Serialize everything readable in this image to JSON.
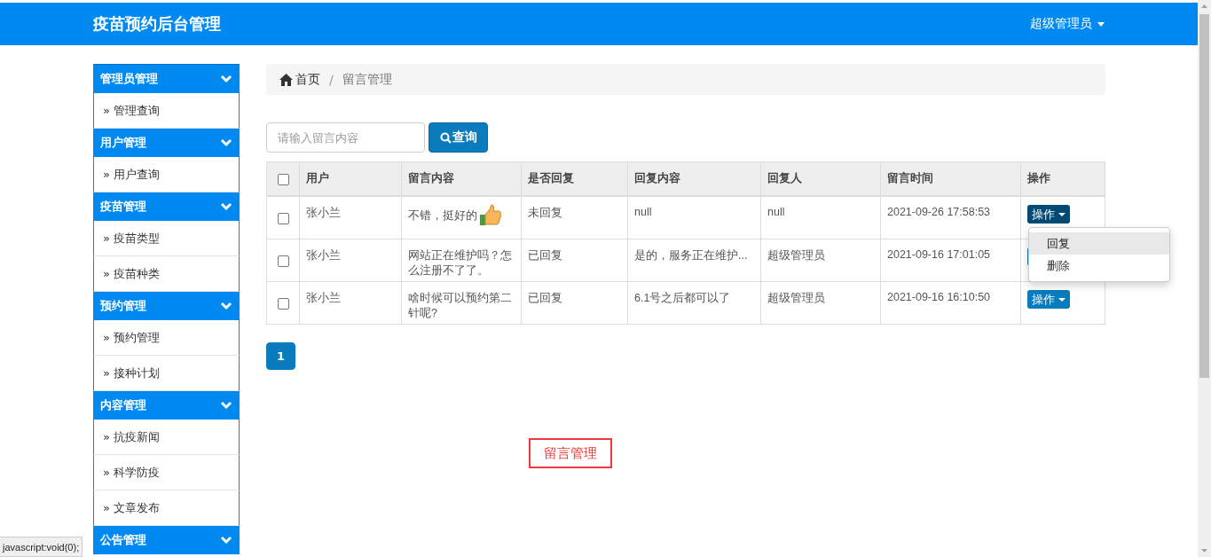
{
  "header": {
    "title": "疫苗预约后台管理",
    "user_menu": "超级管理员"
  },
  "sidebar": {
    "groups": [
      {
        "title": "管理员管理",
        "items": [
          "» 管理查询"
        ]
      },
      {
        "title": "用户管理",
        "items": [
          "» 用户查询"
        ]
      },
      {
        "title": "疫苗管理",
        "items": [
          "» 疫苗类型",
          "» 疫苗种类"
        ]
      },
      {
        "title": "预约管理",
        "items": [
          "» 预约管理",
          "» 接种计划"
        ]
      },
      {
        "title": "内容管理",
        "items": [
          "» 抗疫新闻",
          "» 科学防疫",
          "» 文章发布"
        ]
      },
      {
        "title": "公告管理"
      }
    ]
  },
  "breadcrumb": {
    "home": "首页",
    "separator": "/",
    "current": "留言管理"
  },
  "search": {
    "placeholder": "请输入留言内容",
    "button": "查询"
  },
  "table": {
    "columns": [
      "用户",
      "留言内容",
      "是否回复",
      "回复内容",
      "回复人",
      "留言时间",
      "操作"
    ],
    "header_checked": false,
    "rows": [
      {
        "checked": false,
        "user": "张小兰",
        "content": "不错，挺好的",
        "emoticon": true,
        "replied": "未回复",
        "reply": "null",
        "replier": "null",
        "time": "2021-09-26 17:58:53",
        "action": "操作",
        "open": true,
        "menu": [
          {
            "label": "回复",
            "selected": true
          },
          {
            "label": "删除",
            "selected": false
          }
        ]
      },
      {
        "checked": false,
        "user": "张小兰",
        "content": "网站正在维护吗？怎么注册不了了。",
        "emoticon": false,
        "replied": "已回复",
        "reply": "是的，服务正在维护...",
        "replier": "超级管理员",
        "time": "2021-09-16 17:01:05",
        "open": false
      },
      {
        "checked": false,
        "user": "张小兰",
        "content": "啥时候可以预约第二针呢?",
        "emoticon": false,
        "replied": "已回复",
        "reply": "6.1号之后都可以了",
        "replier": "超级管理员",
        "time": "2021-09-16 16:10:50",
        "action": "操作",
        "open": false
      }
    ]
  },
  "pagination": [
    {
      "label": "1",
      "selected": true
    }
  ],
  "annotation": "留言管理",
  "status_bar": "javascript:void(0);"
}
